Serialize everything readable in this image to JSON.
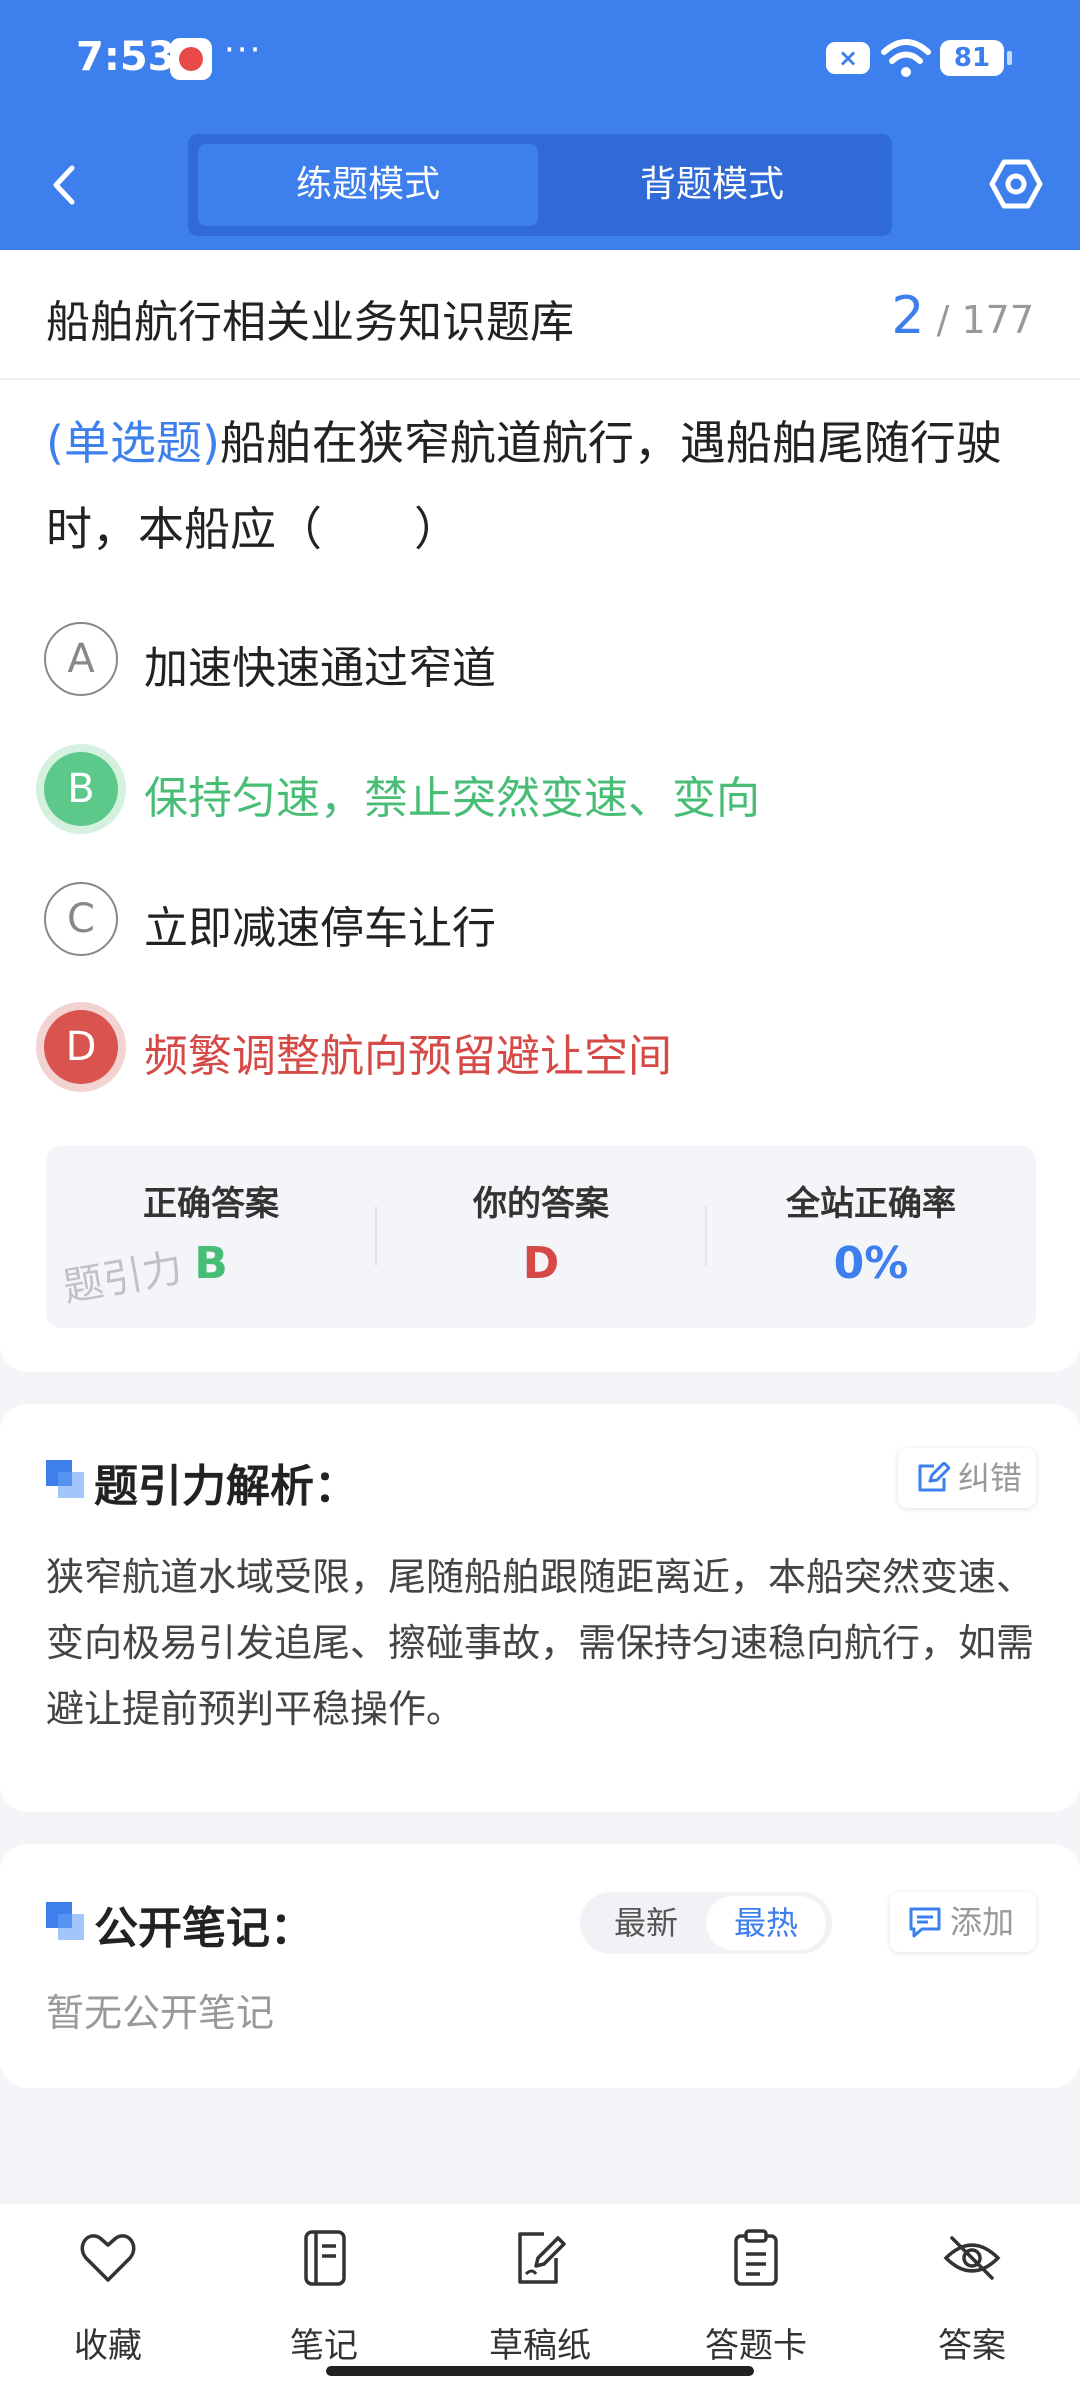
{
  "status_bar": {
    "time": "7:53",
    "dots": "···",
    "battery": "81"
  },
  "header": {
    "mode_tabs": [
      {
        "label": "练题模式",
        "active": true
      },
      {
        "label": "背题模式",
        "active": false
      }
    ]
  },
  "bank": {
    "title": "船舶航行相关业务知识题库",
    "current": "2",
    "total": "/ 177"
  },
  "question": {
    "type": "(单选题)",
    "text": "船舶在狭窄航道航行，遇船舶尾随行驶时，本船应（　　）",
    "options": [
      {
        "letter": "A",
        "text": "加速快速通过窄道",
        "state": "normal"
      },
      {
        "letter": "B",
        "text": "保持匀速，禁止突然变速、变向",
        "state": "correct"
      },
      {
        "letter": "C",
        "text": "立即减速停车让行",
        "state": "normal"
      },
      {
        "letter": "D",
        "text": "频繁调整航向预留避让空间",
        "state": "wrong"
      }
    ]
  },
  "answer_summary": {
    "correct_label": "正确答案",
    "correct_value": "B",
    "yours_label": "你的答案",
    "yours_value": "D",
    "rate_label": "全站正确率",
    "rate_value": "0%",
    "watermark": "题引力"
  },
  "analysis": {
    "title": "题引力解析：",
    "report_label": "纠错",
    "text": "狭窄航道水域受限，尾随船舶跟随距离近，本船突然变速、变向极易引发追尾、擦碰事故，需保持匀速稳向航行，如需避让提前预判平稳操作。"
  },
  "notes": {
    "title": "公开笔记：",
    "sort_latest": "最新",
    "sort_hot": "最热",
    "add_label": "添加",
    "empty_text": "暂无公开笔记"
  },
  "toolbar": {
    "items": [
      {
        "label": "收藏",
        "icon": "heart-icon"
      },
      {
        "label": "笔记",
        "icon": "notebook-icon"
      },
      {
        "label": "草稿纸",
        "icon": "draft-icon"
      },
      {
        "label": "答题卡",
        "icon": "clipboard-icon"
      },
      {
        "label": "答案",
        "icon": "eye-off-icon"
      }
    ]
  },
  "colors": {
    "primary": "#3d7fec",
    "correct": "#48bd76",
    "wrong": "#d54a46"
  }
}
